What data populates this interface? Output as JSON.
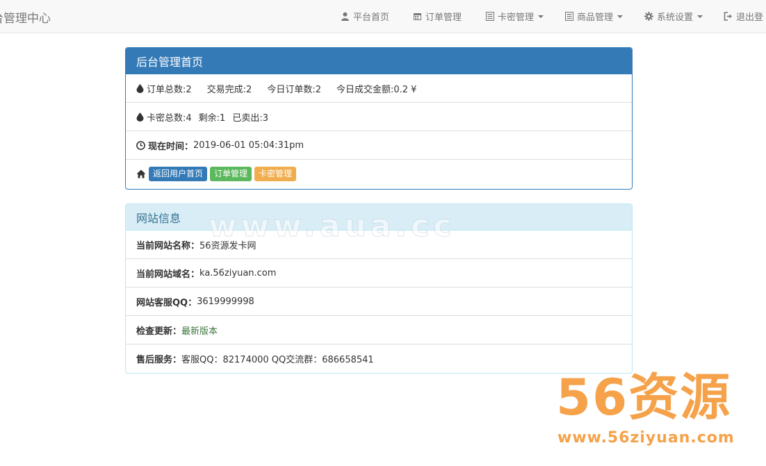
{
  "navbar": {
    "brand": "台管理中心",
    "items": [
      {
        "label": "平台首页",
        "icon": "user-icon",
        "dropdown": false
      },
      {
        "label": "订单管理",
        "icon": "calendar-icon",
        "dropdown": false
      },
      {
        "label": "卡密管理",
        "icon": "list-icon",
        "dropdown": true
      },
      {
        "label": "商品管理",
        "icon": "list-icon",
        "dropdown": true
      },
      {
        "label": "系统设置",
        "icon": "gear-icon",
        "dropdown": true
      },
      {
        "label": "退出登",
        "icon": "logout-icon",
        "dropdown": false
      }
    ]
  },
  "home_panel": {
    "title": "后台管理首页",
    "order_stats": [
      "订单总数:2",
      "交易完成:2",
      "今日订单数:2",
      "今日成交金额:0.2 ¥"
    ],
    "card_stats": [
      "卡密总数:4",
      "剩余:1",
      "已卖出:3"
    ],
    "time_label": "现在时间：",
    "time_value": "2019-06-01 05:04:31pm",
    "buttons": [
      "返回用户首页",
      "订单管理",
      "卡密管理"
    ]
  },
  "site_panel": {
    "title": "网站信息",
    "rows": [
      {
        "label": "当前网站名称：",
        "value": "56资源发卡网"
      },
      {
        "label": "当前网站域名：",
        "value": "ka.56ziyuan.com"
      },
      {
        "label": "网站客服QQ：",
        "value": "3619999998"
      },
      {
        "label": "检查更新：",
        "value": "最新版本"
      },
      {
        "label": "售后服务：",
        "value": "客服QQ：82174000 QQ交流群：686658541"
      }
    ]
  },
  "watermark": {
    "text": "www.aua.cc",
    "logo_main": "56资源",
    "logo_url": "www.56ziyuan.com"
  },
  "colors": {
    "primary": "#337ab7",
    "success": "#5cb85c",
    "warning": "#f0ad4e",
    "info_bg": "#d9edf7",
    "watermark_orange": "#f5a24a"
  }
}
